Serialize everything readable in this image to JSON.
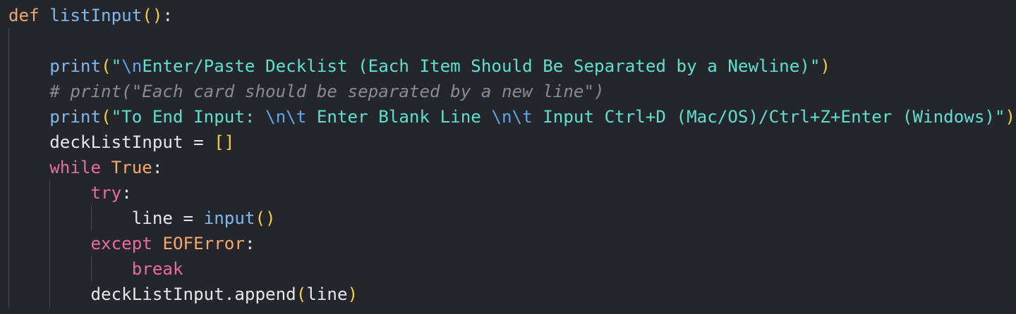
{
  "editor": {
    "language": "python",
    "theme": {
      "background": "#25262b",
      "default": "#e6e6e6",
      "keyword": "#e8a775",
      "control": "#e56da3",
      "function": "#7eb8ee",
      "string": "#5de0d0",
      "escape": "#5ba8f0",
      "bracket": "#f2d33f",
      "comment": "#8a8b90",
      "constant": "#f2a96e",
      "indent_guide": "#4a4b50"
    },
    "lines": [
      {
        "n": 1,
        "tokens": [
          {
            "t": "def",
            "k": "keyword"
          },
          {
            "t": " ",
            "k": "default"
          },
          {
            "t": "listInput",
            "k": "function"
          },
          {
            "t": "()",
            "k": "bracket"
          },
          {
            "t": ":",
            "k": "default"
          }
        ]
      },
      {
        "n": 2,
        "tokens": []
      },
      {
        "n": 3,
        "tokens": [
          {
            "t": "    ",
            "k": "default"
          },
          {
            "t": "print",
            "k": "function"
          },
          {
            "t": "(",
            "k": "bracket"
          },
          {
            "t": "\"",
            "k": "string"
          },
          {
            "t": "\\n",
            "k": "escape"
          },
          {
            "t": "Enter/Paste Decklist (Each Item Should Be Separated by a Newline)\"",
            "k": "string"
          },
          {
            "t": ")",
            "k": "bracket"
          }
        ]
      },
      {
        "n": 4,
        "tokens": [
          {
            "t": "    ",
            "k": "default"
          },
          {
            "t": "# print(\"Each card should be separated by a new line\")",
            "k": "comment"
          }
        ]
      },
      {
        "n": 5,
        "tokens": [
          {
            "t": "    ",
            "k": "default"
          },
          {
            "t": "print",
            "k": "function"
          },
          {
            "t": "(",
            "k": "bracket"
          },
          {
            "t": "\"To End Input: ",
            "k": "string"
          },
          {
            "t": "\\n\\t",
            "k": "escape"
          },
          {
            "t": " Enter Blank Line ",
            "k": "string"
          },
          {
            "t": "\\n\\t",
            "k": "escape"
          },
          {
            "t": " Input Ctrl+D (Mac/OS)/Ctrl+Z+Enter (Windows)\"",
            "k": "string"
          },
          {
            "t": ")",
            "k": "bracket"
          }
        ]
      },
      {
        "n": 6,
        "tokens": [
          {
            "t": "    deckListInput = ",
            "k": "default"
          },
          {
            "t": "[]",
            "k": "bracket"
          }
        ]
      },
      {
        "n": 7,
        "tokens": [
          {
            "t": "    ",
            "k": "default"
          },
          {
            "t": "while",
            "k": "control"
          },
          {
            "t": " ",
            "k": "default"
          },
          {
            "t": "True",
            "k": "constant"
          },
          {
            "t": ":",
            "k": "default"
          }
        ]
      },
      {
        "n": 8,
        "tokens": [
          {
            "t": "        ",
            "k": "default"
          },
          {
            "t": "try",
            "k": "control"
          },
          {
            "t": ":",
            "k": "default"
          }
        ]
      },
      {
        "n": 9,
        "tokens": [
          {
            "t": "            line = ",
            "k": "default"
          },
          {
            "t": "input",
            "k": "function"
          },
          {
            "t": "()",
            "k": "bracket"
          }
        ]
      },
      {
        "n": 10,
        "tokens": [
          {
            "t": "        ",
            "k": "default"
          },
          {
            "t": "except",
            "k": "control"
          },
          {
            "t": " ",
            "k": "default"
          },
          {
            "t": "EOFError",
            "k": "constant"
          },
          {
            "t": ":",
            "k": "default"
          }
        ]
      },
      {
        "n": 11,
        "tokens": [
          {
            "t": "            ",
            "k": "default"
          },
          {
            "t": "break",
            "k": "control"
          }
        ]
      },
      {
        "n": 12,
        "tokens": [
          {
            "t": "        deckListInput.append",
            "k": "default"
          },
          {
            "t": "(",
            "k": "bracket"
          },
          {
            "t": "line",
            "k": "default"
          },
          {
            "t": ")",
            "k": "bracket"
          }
        ]
      }
    ]
  }
}
